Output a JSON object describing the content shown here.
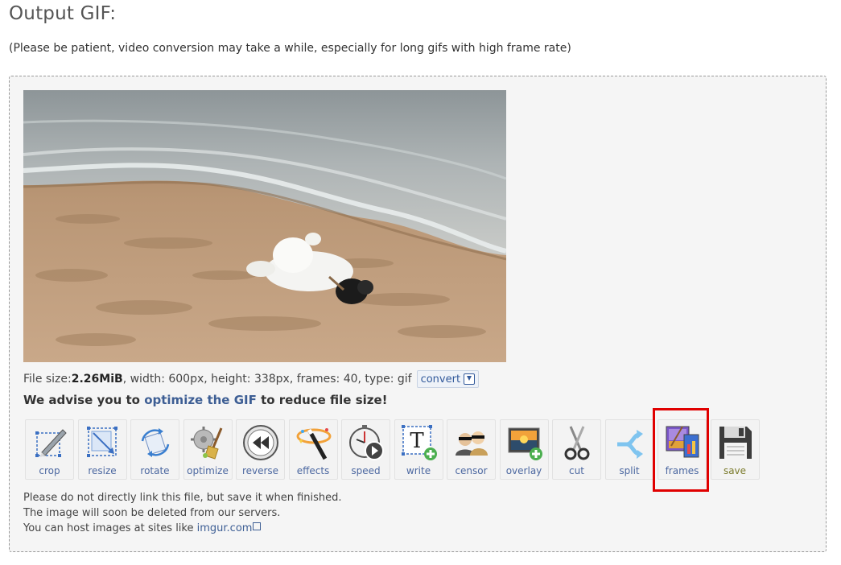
{
  "heading": "Output GIF:",
  "note": "(Please be patient, video conversion may take a while, especially for long gifs with high frame rate)",
  "file_info": {
    "prefix": "File size: ",
    "size": "2.26MiB",
    "rest": ", width: 600px, height: 338px, frames: 40, type: gif",
    "convert_label": "convert"
  },
  "advice": {
    "before": "We advise you to ",
    "link": "optimize the GIF",
    "after": " to reduce file size!"
  },
  "tools": [
    {
      "label": "crop",
      "icon": "crop-icon"
    },
    {
      "label": "resize",
      "icon": "resize-icon"
    },
    {
      "label": "rotate",
      "icon": "rotate-icon"
    },
    {
      "label": "optimize",
      "icon": "broom-icon"
    },
    {
      "label": "reverse",
      "icon": "rewind-icon"
    },
    {
      "label": "effects",
      "icon": "magic-wand-icon"
    },
    {
      "label": "speed",
      "icon": "stopwatch-icon"
    },
    {
      "label": "write",
      "icon": "text-icon"
    },
    {
      "label": "censor",
      "icon": "censor-people-icon"
    },
    {
      "label": "overlay",
      "icon": "overlay-image-icon"
    },
    {
      "label": "cut",
      "icon": "scissors-icon"
    },
    {
      "label": "split",
      "icon": "split-arrows-icon"
    },
    {
      "label": "frames",
      "icon": "frames-icon"
    },
    {
      "label": "save",
      "icon": "floppy-disk-icon"
    }
  ],
  "footer": {
    "line1": "Please do not directly link this file, but save it when finished.",
    "line2": "The image will soon be deleted from our servers.",
    "line3_prefix": "You can host images at sites like ",
    "line3_link": "imgur.com"
  },
  "colors": {
    "link": "#3d5e94",
    "highlight": "#e00000",
    "panel_bg": "#f5f5f5"
  }
}
